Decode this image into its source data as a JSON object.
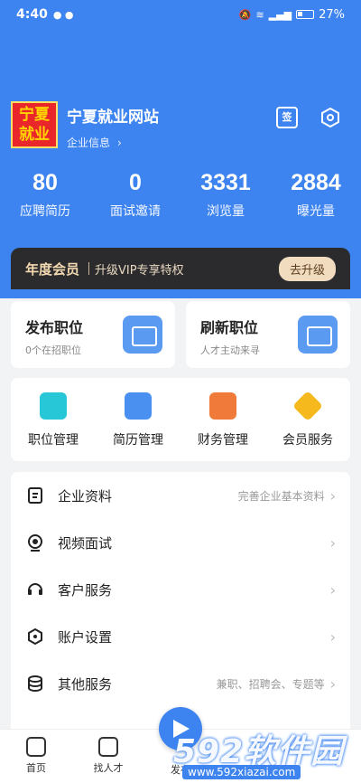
{
  "status": {
    "time": "4:40",
    "battery": "27%"
  },
  "company": {
    "logo_line1": "宁夏",
    "logo_line2": "就业",
    "name": "宁夏就业网站",
    "link": "企业信息"
  },
  "top_icons": {
    "calendar_label": "签"
  },
  "stats": [
    {
      "value": "80",
      "label": "应聘简历"
    },
    {
      "value": "0",
      "label": "面试邀请"
    },
    {
      "value": "3331",
      "label": "浏览量"
    },
    {
      "value": "2884",
      "label": "曝光量"
    }
  ],
  "vip": {
    "title": "年度会员",
    "desc": "升级VIP专享特权",
    "button": "去升级"
  },
  "cards": [
    {
      "title": "发布职位",
      "sub": "0个在招职位"
    },
    {
      "title": "刷新职位",
      "sub": "人才主动来寻"
    }
  ],
  "grid": [
    {
      "label": "职位管理",
      "color": "#27c7d8"
    },
    {
      "label": "简历管理",
      "color": "#4a90f0"
    },
    {
      "label": "财务管理",
      "color": "#f07a3a"
    },
    {
      "label": "会员服务",
      "color": "#f5b91e"
    }
  ],
  "menu": [
    {
      "label": "企业资料",
      "hint": "完善企业基本资料"
    },
    {
      "label": "视频面试",
      "hint": ""
    },
    {
      "label": "客户服务",
      "hint": ""
    },
    {
      "label": "账户设置",
      "hint": ""
    },
    {
      "label": "其他服务",
      "hint": "兼职、招聘会、专题等"
    }
  ],
  "tabs": [
    {
      "label": "首页"
    },
    {
      "label": "找人才"
    },
    {
      "label": "发布"
    }
  ],
  "watermark": {
    "brand": "592软件园",
    "url": "www.592xiazai.com"
  },
  "colors": {
    "primary": "#3d84f0",
    "vip_bg": "#2b2b2e",
    "vip_gold": "#f3d8b0"
  }
}
